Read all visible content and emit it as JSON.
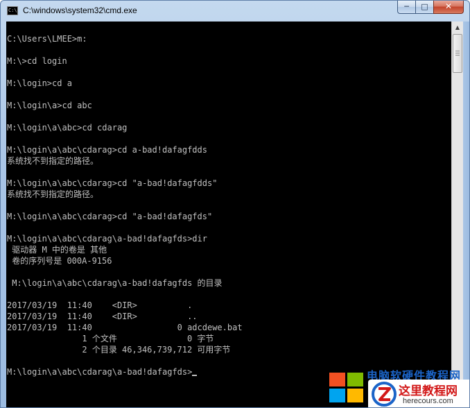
{
  "window": {
    "title": "C:\\windows\\system32\\cmd.exe",
    "icon": "cmd-icon",
    "icon_text": "C:\\",
    "controls": {
      "minimize": "─",
      "maximize": "□",
      "close": "✕"
    }
  },
  "console": {
    "lines": [
      "C:\\Users\\LMEE>m:",
      "",
      "M:\\>cd login",
      "",
      "M:\\login>cd a",
      "",
      "M:\\login\\a>cd abc",
      "",
      "M:\\login\\a\\abc>cd cdarag",
      "",
      "M:\\login\\a\\abc\\cdarag>cd a-bad!dafagfdds",
      "系统找不到指定的路径。",
      "",
      "M:\\login\\a\\abc\\cdarag>cd \"a-bad!dafagfdds\"",
      "系统找不到指定的路径。",
      "",
      "M:\\login\\a\\abc\\cdarag>cd \"a-bad!dafagfds\"",
      "",
      "M:\\login\\a\\abc\\cdarag\\a-bad!dafagfds>dir",
      " 驱动器 M 中的卷是 其他",
      " 卷的序列号是 000A-9156",
      "",
      " M:\\login\\a\\abc\\cdarag\\a-bad!dafagfds 的目录",
      "",
      "2017/03/19  11:40    <DIR>          .",
      "2017/03/19  11:40    <DIR>          ..",
      "2017/03/19  11:40                 0 adcdewe.bat",
      "               1 个文件              0 字节",
      "               2 个目录 46,346,739,712 可用字节",
      ""
    ],
    "prompt": "M:\\login\\a\\abc\\cdarag\\a-bad!dafagfds>",
    "text_color": "#c0c0c0",
    "background": "#000000"
  },
  "scrollbar": {
    "up_arrow": "▲"
  },
  "watermark": {
    "banner": "电脑软硬件教程网",
    "title": "这里教程网",
    "url": "herecours.com"
  }
}
